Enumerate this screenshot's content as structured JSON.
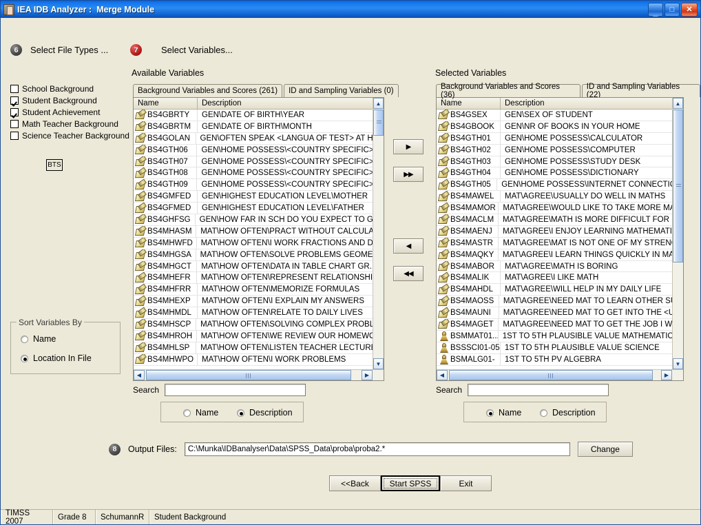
{
  "window": {
    "title": "IEA IDB Analyzer :  Merge Module",
    "app_icon": "app-window-icon",
    "minimize_glyph": "_",
    "maximize_glyph": "□",
    "close_glyph": "✕"
  },
  "steps": {
    "step1_number": "6",
    "step1_label": "Select File Types ...",
    "step2_number": "7",
    "step2_label": "Select Variables...",
    "step3_number": "8"
  },
  "file_types": {
    "items": [
      {
        "label": "School Background",
        "checked": false
      },
      {
        "label": "Student Background",
        "checked": true
      },
      {
        "label": "Student Achievement",
        "checked": true
      },
      {
        "label": "Math Teacher Background",
        "checked": false
      },
      {
        "label": "Science Teacher Background",
        "checked": false
      }
    ],
    "bts_button": "BTS"
  },
  "sort_variables": {
    "title": "Sort Variables By",
    "options": [
      {
        "label": "Name",
        "selected": false
      },
      {
        "label": "Location In File",
        "selected": true
      }
    ]
  },
  "available": {
    "caption": "Available Variables",
    "tabs": [
      {
        "label": "Background Variables and Scores (261)",
        "active": true
      },
      {
        "label": "ID  and Sampling Variables (0)",
        "active": false
      }
    ],
    "columns": {
      "name": "Name",
      "description": "Description"
    },
    "rows": [
      {
        "icon": "pencil",
        "name": "BS4GBRTY",
        "description": "GEN\\DATE OF BIRTH\\YEAR"
      },
      {
        "icon": "pencil",
        "name": "BS4GBRTM",
        "description": "GEN\\DATE OF BIRTH\\MONTH"
      },
      {
        "icon": "pencil",
        "name": "BS4GOLAN",
        "description": "GEN\\OFTEN SPEAK <LANGUA OF TEST> AT H.."
      },
      {
        "icon": "pencil",
        "name": "BS4GTH06",
        "description": "GEN\\HOME POSSESS\\<COUNTRY SPECIFIC>"
      },
      {
        "icon": "pencil",
        "name": "BS4GTH07",
        "description": "GEN\\HOME POSSESS\\<COUNTRY SPECIFIC>"
      },
      {
        "icon": "pencil",
        "name": "BS4GTH08",
        "description": "GEN\\HOME POSSESS\\<COUNTRY SPECIFIC>"
      },
      {
        "icon": "pencil",
        "name": "BS4GTH09",
        "description": "GEN\\HOME POSSESS\\<COUNTRY SPECIFIC>"
      },
      {
        "icon": "pencil",
        "name": "BS4GMFED",
        "description": "GEN\\HIGHEST EDUCATION LEVEL\\MOTHER"
      },
      {
        "icon": "pencil",
        "name": "BS4GFMED",
        "description": "GEN\\HIGHEST EDUCATION LEVEL\\FATHER"
      },
      {
        "icon": "pencil",
        "name": "BS4GHFSG",
        "description": "GEN\\HOW FAR IN SCH DO YOU EXPECT TO GO"
      },
      {
        "icon": "pencil",
        "name": "BS4MHASM",
        "description": "MAT\\HOW OFTEN\\PRACT WITHOUT CALCULA."
      },
      {
        "icon": "pencil",
        "name": "BS4MHWFD",
        "description": "MAT\\HOW OFTEN\\I WORK FRACTIONS AND D."
      },
      {
        "icon": "pencil",
        "name": "BS4MHGSA",
        "description": "MAT\\HOW OFTEN\\SOLVE PROBLEMS GEOME.."
      },
      {
        "icon": "pencil",
        "name": "BS4MHGCT",
        "description": "MAT\\HOW OFTEN\\DATA IN TABLE CHART GR.."
      },
      {
        "icon": "pencil",
        "name": "BS4MHEFR",
        "description": "MAT\\HOW OFTEN\\REPRESENT RELATIONSHI."
      },
      {
        "icon": "pencil",
        "name": "BS4MHFRR",
        "description": "MAT\\HOW OFTEN\\MEMORIZE FORMULAS"
      },
      {
        "icon": "pencil",
        "name": "BS4MHEXP",
        "description": "MAT\\HOW OFTEN\\I EXPLAIN MY ANSWERS"
      },
      {
        "icon": "pencil",
        "name": "BS4MHMDL",
        "description": "MAT\\HOW OFTEN\\RELATE TO DAILY LIVES"
      },
      {
        "icon": "pencil",
        "name": "BS4MHSCP",
        "description": "MAT\\HOW OFTEN\\SOLVING COMPLEX PROBL."
      },
      {
        "icon": "pencil",
        "name": "BS4MHROH",
        "description": "MAT\\HOW OFTEN\\WE REVIEW OUR HOMEWO"
      },
      {
        "icon": "pencil",
        "name": "BS4MHLSP",
        "description": "MAT\\HOW OFTEN\\LISTEN TEACHER LECTURE"
      },
      {
        "icon": "pencil",
        "name": "BS4MHWPO",
        "description": "MAT\\HOW OFTEN\\I WORK PROBLEMS"
      }
    ],
    "search": {
      "label": "Search",
      "value": "",
      "options": [
        {
          "label": "Name",
          "selected": false
        },
        {
          "label": "Description",
          "selected": true
        }
      ]
    }
  },
  "selected": {
    "caption": "Selected Variables",
    "tabs": [
      {
        "label": "Background Variables and Scores (36)",
        "active": true
      },
      {
        "label": "ID  and Sampling Variables (22)",
        "active": false
      }
    ],
    "columns": {
      "name": "Name",
      "description": "Description"
    },
    "rows": [
      {
        "icon": "pencil",
        "name": "BS4GSEX",
        "description": "GEN\\SEX OF STUDENT"
      },
      {
        "icon": "pencil",
        "name": "BS4GBOOK",
        "description": "GEN\\NR OF BOOKS IN YOUR HOME"
      },
      {
        "icon": "pencil",
        "name": "BS4GTH01",
        "description": "GEN\\HOME POSSESS\\CALCULATOR"
      },
      {
        "icon": "pencil",
        "name": "BS4GTH02",
        "description": "GEN\\HOME POSSESS\\COMPUTER"
      },
      {
        "icon": "pencil",
        "name": "BS4GTH03",
        "description": "GEN\\HOME POSSESS\\STUDY DESK"
      },
      {
        "icon": "pencil",
        "name": "BS4GTH04",
        "description": "GEN\\HOME POSSESS\\DICTIONARY"
      },
      {
        "icon": "pencil",
        "name": "BS4GTH05",
        "description": "GEN\\HOME POSSESS\\INTERNET CONNECTION"
      },
      {
        "icon": "pencil",
        "name": "BS4MAWEL",
        "description": "MAT\\AGREE\\USUALLY DO WELL IN MATHS"
      },
      {
        "icon": "pencil",
        "name": "BS4MAMOR",
        "description": "MAT\\AGREE\\WOULD LIKE TO TAKE MORE MA."
      },
      {
        "icon": "pencil",
        "name": "BS4MACLM",
        "description": "MAT\\AGREE\\MATH IS MORE DIFFICULT FOR M"
      },
      {
        "icon": "pencil",
        "name": "BS4MAENJ",
        "description": "MAT\\AGREE\\I ENJOY LEARNING MATHEMATIC"
      },
      {
        "icon": "pencil",
        "name": "BS4MASTR",
        "description": "MAT\\AGREE\\MAT IS NOT ONE OF MY STRENG"
      },
      {
        "icon": "pencil",
        "name": "BS4MAQKY",
        "description": "MAT\\AGREE\\I LEARN THINGS QUICKLY IN MAT"
      },
      {
        "icon": "pencil",
        "name": "BS4MABOR",
        "description": "MAT\\AGREE\\MATH IS BORING"
      },
      {
        "icon": "pencil",
        "name": "BS4MALIK",
        "description": "MAT\\AGREE\\I LIKE MATH"
      },
      {
        "icon": "pencil",
        "name": "BS4MAHDL",
        "description": "MAT\\AGREE\\WILL HELP IN MY DAILY LIFE"
      },
      {
        "icon": "pencil",
        "name": "BS4MAOSS",
        "description": "MAT\\AGREE\\NEED MAT TO LEARN OTHER SU"
      },
      {
        "icon": "pencil",
        "name": "BS4MAUNI",
        "description": "MAT\\AGREE\\NEED MAT TO GET INTO THE <U."
      },
      {
        "icon": "pencil",
        "name": "BS4MAGET",
        "description": "MAT\\AGREE\\NEED MAT TO GET THE JOB I WA"
      },
      {
        "icon": "pawn",
        "name": "BSMMAT01...",
        "description": "1ST TO 5TH PLAUSIBLE VALUE MATHEMATICS"
      },
      {
        "icon": "pawn",
        "name": "BSSSCI01-05",
        "description": "1ST TO 5TH PLAUSIBLE VALUE SCIENCE"
      },
      {
        "icon": "pawn",
        "name": "BSMALG01-",
        "description": "1ST TO 5TH PV ALGEBRA"
      }
    ],
    "search": {
      "label": "Search",
      "value": "",
      "options": [
        {
          "label": "Name",
          "selected": true
        },
        {
          "label": "Description",
          "selected": false
        }
      ]
    }
  },
  "transfer_buttons": [
    {
      "name": "move-right",
      "glyph": "▶"
    },
    {
      "name": "move-all-right",
      "glyph": "▶▶"
    },
    {
      "name": "move-left",
      "glyph": "◀"
    },
    {
      "name": "move-all-left",
      "glyph": "◀◀"
    }
  ],
  "output": {
    "label": "Output Files:",
    "path": "C:\\Munka\\IDBanalyser\\Data\\SPSS_Data\\proba\\proba2.*",
    "change_button": "Change"
  },
  "nav": {
    "back": "<<Back",
    "start": "Start SPSS",
    "exit": "Exit"
  },
  "statusbar": {
    "study": "TIMSS 2007",
    "grade": "Grade 8",
    "user": "SchumannR",
    "filetype": "Student Background"
  },
  "colors": {
    "titlebar_blue": "#1073ec",
    "face": "#ece9d8",
    "step_red": "#a50d0d",
    "step_gray": "#3a3a3a"
  }
}
